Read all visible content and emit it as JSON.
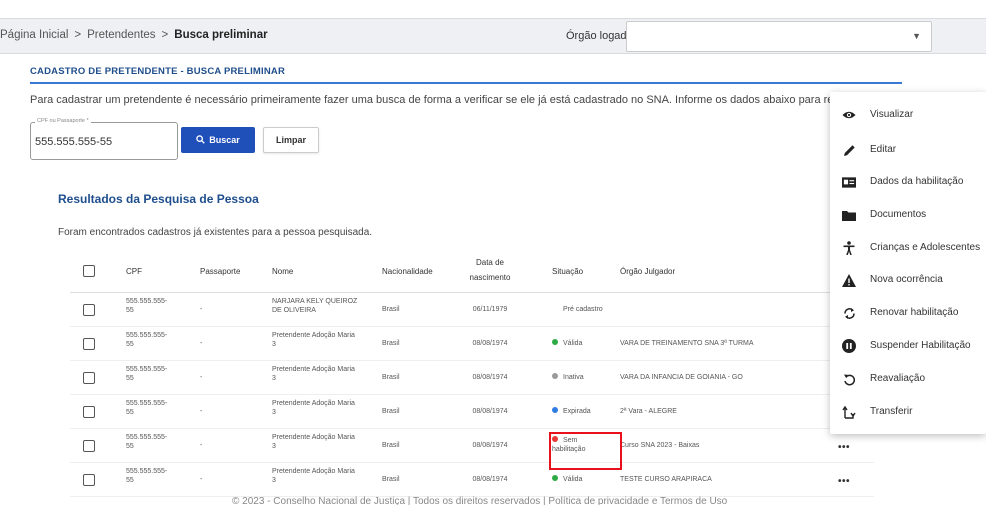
{
  "breadcrumb": {
    "items": [
      "Página Inicial",
      "Pretendentes"
    ],
    "current": "Busca preliminar",
    "separator": ">"
  },
  "header": {
    "orgao_label": "Órgão logado",
    "orgao_value": ""
  },
  "section_title": "CADASTRO DE PRETENDENTE - BUSCA PRELIMINAR",
  "intro_text": "Para cadastrar um pretendente é necessário primeiramente fazer uma busca de forma a verificar se ele já está cadastrado no SNA. Informe os dados abaixo para realizar essa pesqu",
  "search": {
    "cpf_label": "CPF ou Passaporte *",
    "cpf_value": "555.555.555-55",
    "buscar_label": "Buscar",
    "limpar_label": "Limpar"
  },
  "results": {
    "title": "Resultados da Pesquisa de Pessoa",
    "subtitle": "Foram encontrados cadastros já existentes para a pessoa pesquisada."
  },
  "table": {
    "headers": {
      "cpf": "CPF",
      "passaporte": "Passaporte",
      "nome": "Nome",
      "nacionalidade": "Nacionalidade",
      "nascimento_1": "Data de",
      "nascimento_2": "nascimento",
      "situacao": "Situação",
      "orgao": "Órgão Julgador"
    },
    "rows": [
      {
        "cpf_1": "555.555.555-",
        "cpf_2": "55",
        "passaporte": "-",
        "nome_1": "NARJARA KELY QUEIROZ",
        "nome_2": "DE OLIVEIRA",
        "nacionalidade": "Brasil",
        "nascimento": "06/11/1979",
        "situacao": "Pré cadastro",
        "situacao_1": "",
        "situacao_2": "",
        "status_color": "",
        "orgao": "",
        "actions": ""
      },
      {
        "cpf_1": "555.555.555-",
        "cpf_2": "55",
        "passaporte": "-",
        "nome_1": "Pretendente Adoção Maria",
        "nome_2": "3",
        "nacionalidade": "Brasil",
        "nascimento": "08/08/1974",
        "situacao": "Válida",
        "situacao_1": "",
        "situacao_2": "",
        "status_color": "#2eaa44",
        "orgao": "VARA DE TREINAMENTO SNA 3ª TURMA",
        "actions": ""
      },
      {
        "cpf_1": "555.555.555-",
        "cpf_2": "55",
        "passaporte": "-",
        "nome_1": "Pretendente Adoção Maria",
        "nome_2": "3",
        "nacionalidade": "Brasil",
        "nascimento": "08/08/1974",
        "situacao": "Inativa",
        "situacao_1": "",
        "situacao_2": "",
        "status_color": "#9a9a9a",
        "orgao": "VARA DA INFANCIA DE GOIANIA - GO",
        "actions": ""
      },
      {
        "cpf_1": "555.555.555-",
        "cpf_2": "55",
        "passaporte": "-",
        "nome_1": "Pretendente Adoção Maria",
        "nome_2": "3",
        "nacionalidade": "Brasil",
        "nascimento": "08/08/1974",
        "situacao": "Expirada",
        "situacao_1": "",
        "situacao_2": "",
        "status_color": "#2f7de1",
        "orgao": "2ª Vara - ALEGRE",
        "actions": ""
      },
      {
        "cpf_1": "555.555.555-",
        "cpf_2": "55",
        "passaporte": "-",
        "nome_1": "Pretendente Adoção Maria",
        "nome_2": "3",
        "nacionalidade": "Brasil",
        "nascimento": "08/08/1974",
        "situacao": "",
        "situacao_1": "Sem",
        "situacao_2": "habilitação",
        "status_color": "#e53935",
        "orgao": "Curso SNA 2023 - Baixas",
        "actions": "•••"
      },
      {
        "cpf_1": "555.555.555-",
        "cpf_2": "55",
        "passaporte": "-",
        "nome_1": "Pretendente Adoção Maria",
        "nome_2": "3",
        "nacionalidade": "Brasil",
        "nascimento": "08/08/1974",
        "situacao": "Válida",
        "situacao_1": "",
        "situacao_2": "",
        "status_color": "#2eaa44",
        "orgao": "TESTE CURSO ARAPIRACA",
        "actions": "•••"
      }
    ]
  },
  "context_menu": {
    "items": [
      {
        "label": "Visualizar",
        "icon": "eye-icon"
      },
      {
        "label": "Editar",
        "icon": "pencil-icon"
      },
      {
        "label": "Dados da habilitação",
        "icon": "id-card-icon"
      },
      {
        "label": "Documentos",
        "icon": "folder-icon"
      },
      {
        "label": "Crianças e Adolescentes",
        "icon": "child-icon"
      },
      {
        "label": "Nova ocorrência",
        "icon": "warning-icon"
      },
      {
        "label": "Renovar habilitação",
        "icon": "renew-icon"
      },
      {
        "label": "Suspender Habilitação",
        "icon": "pause-icon"
      },
      {
        "label": "Reavaliação",
        "icon": "undo-icon"
      },
      {
        "label": "Transferir",
        "icon": "transfer-icon"
      }
    ]
  },
  "footer": "© 2023 - Conselho Nacional de Justiça | Todos os direitos reservados | Política de privacidade e Termos de Uso"
}
